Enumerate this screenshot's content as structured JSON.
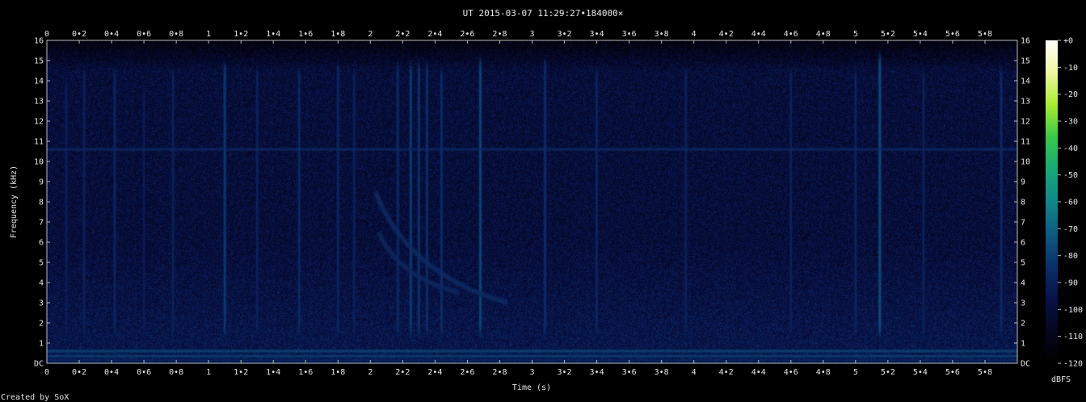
{
  "chart_data": {
    "type": "heatmap",
    "title": "UT 2015-03-07 11:29:27•184000×",
    "xlabel": "Time (s)",
    "ylabel": "Frequency (kHz)",
    "xlim": [
      0,
      6
    ],
    "ylim": [
      0,
      16
    ],
    "x_ticks": [
      {
        "v": 0,
        "label": "0"
      },
      {
        "v": 0.2,
        "label": "0•2"
      },
      {
        "v": 0.4,
        "label": "0•4"
      },
      {
        "v": 0.6,
        "label": "0•6"
      },
      {
        "v": 0.8,
        "label": "0•8"
      },
      {
        "v": 1,
        "label": "1"
      },
      {
        "v": 1.2,
        "label": "1•2"
      },
      {
        "v": 1.4,
        "label": "1•4"
      },
      {
        "v": 1.6,
        "label": "1•6"
      },
      {
        "v": 1.8,
        "label": "1•8"
      },
      {
        "v": 2,
        "label": "2"
      },
      {
        "v": 2.2,
        "label": "2•2"
      },
      {
        "v": 2.4,
        "label": "2•4"
      },
      {
        "v": 2.6,
        "label": "2•6"
      },
      {
        "v": 2.8,
        "label": "2•8"
      },
      {
        "v": 3,
        "label": "3"
      },
      {
        "v": 3.2,
        "label": "3•2"
      },
      {
        "v": 3.4,
        "label": "3•4"
      },
      {
        "v": 3.6,
        "label": "3•6"
      },
      {
        "v": 3.8,
        "label": "3•8"
      },
      {
        "v": 4,
        "label": "4"
      },
      {
        "v": 4.2,
        "label": "4•2"
      },
      {
        "v": 4.4,
        "label": "4•4"
      },
      {
        "v": 4.6,
        "label": "4•6"
      },
      {
        "v": 4.8,
        "label": "4•8"
      },
      {
        "v": 5,
        "label": "5"
      },
      {
        "v": 5.2,
        "label": "5•2"
      },
      {
        "v": 5.4,
        "label": "5•4"
      },
      {
        "v": 5.6,
        "label": "5•6"
      },
      {
        "v": 5.8,
        "label": "5•8"
      }
    ],
    "y_ticks": [
      {
        "v": 0,
        "label": "DC"
      },
      {
        "v": 1,
        "label": "1"
      },
      {
        "v": 2,
        "label": "2"
      },
      {
        "v": 3,
        "label": "3"
      },
      {
        "v": 4,
        "label": "4"
      },
      {
        "v": 5,
        "label": "5"
      },
      {
        "v": 6,
        "label": "6"
      },
      {
        "v": 7,
        "label": "7"
      },
      {
        "v": 8,
        "label": "8"
      },
      {
        "v": 9,
        "label": "9"
      },
      {
        "v": 10,
        "label": "10"
      },
      {
        "v": 11,
        "label": "11"
      },
      {
        "v": 12,
        "label": "12"
      },
      {
        "v": 13,
        "label": "13"
      },
      {
        "v": 14,
        "label": "14"
      },
      {
        "v": 15,
        "label": "15"
      },
      {
        "v": 16,
        "label": "16"
      }
    ],
    "colorbar": {
      "label": "dBFS",
      "range": [
        -120,
        0
      ],
      "ticks": [
        {
          "v": 0,
          "label": "+0"
        },
        {
          "v": -10,
          "label": "-10"
        },
        {
          "v": -20,
          "label": "-20"
        },
        {
          "v": -30,
          "label": "-30"
        },
        {
          "v": -40,
          "label": "-40"
        },
        {
          "v": -50,
          "label": "-50"
        },
        {
          "v": -60,
          "label": "-60"
        },
        {
          "v": -70,
          "label": "-70"
        },
        {
          "v": -80,
          "label": "-80"
        },
        {
          "v": -90,
          "label": "-90"
        },
        {
          "v": -100,
          "label": "-100"
        },
        {
          "v": -110,
          "label": "-110"
        },
        {
          "v": -120,
          "label": "-120"
        }
      ],
      "stops": [
        "#000000",
        "#05051e",
        "#08124a",
        "#0a2f6a",
        "#0d5a82",
        "#10878a",
        "#18a878",
        "#38c848",
        "#a8ec30",
        "#f0f8a0",
        "#ffffff"
      ]
    },
    "features": {
      "background_level_db": -100,
      "horizontal_lines": [
        {
          "freq_khz": 10.6,
          "level_db": -85
        },
        {
          "freq_khz": 0.6,
          "level_db": -75
        },
        {
          "freq_khz": 0.35,
          "level_db": -78
        },
        {
          "freq_khz": 0.15,
          "level_db": -88
        }
      ],
      "vertical_impulses": [
        {
          "t": 0.12,
          "top_khz": 14,
          "level_db": -92
        },
        {
          "t": 0.23,
          "top_khz": 14.5,
          "level_db": -90
        },
        {
          "t": 0.42,
          "top_khz": 14.5,
          "level_db": -88
        },
        {
          "t": 0.6,
          "top_khz": 13.5,
          "level_db": -92
        },
        {
          "t": 0.78,
          "top_khz": 14.5,
          "level_db": -90
        },
        {
          "t": 1.1,
          "top_khz": 14.8,
          "level_db": -80
        },
        {
          "t": 1.3,
          "top_khz": 14.5,
          "level_db": -90
        },
        {
          "t": 1.56,
          "top_khz": 14.5,
          "level_db": -86
        },
        {
          "t": 1.8,
          "top_khz": 14.8,
          "level_db": -88
        },
        {
          "t": 1.9,
          "top_khz": 14.5,
          "level_db": -90
        },
        {
          "t": 2.17,
          "top_khz": 14.8,
          "level_db": -86
        },
        {
          "t": 2.25,
          "top_khz": 14.8,
          "level_db": -80
        },
        {
          "t": 2.3,
          "top_khz": 14.8,
          "level_db": -82
        },
        {
          "t": 2.35,
          "top_khz": 14.8,
          "level_db": -84
        },
        {
          "t": 2.44,
          "top_khz": 14.5,
          "level_db": -84
        },
        {
          "t": 2.68,
          "top_khz": 15,
          "level_db": -76
        },
        {
          "t": 3.08,
          "top_khz": 15,
          "level_db": -84
        },
        {
          "t": 3.4,
          "top_khz": 14.5,
          "level_db": -88
        },
        {
          "t": 3.95,
          "top_khz": 14.5,
          "level_db": -90
        },
        {
          "t": 4.6,
          "top_khz": 14.5,
          "level_db": -90
        },
        {
          "t": 5.0,
          "top_khz": 14.5,
          "level_db": -88
        },
        {
          "t": 5.15,
          "top_khz": 15.2,
          "level_db": -74
        },
        {
          "t": 5.42,
          "top_khz": 14.5,
          "level_db": -90
        },
        {
          "t": 5.9,
          "top_khz": 14.5,
          "level_db": -86
        }
      ],
      "whistler_traces": [
        {
          "t_start": 2.03,
          "f_start_khz": 8.5,
          "t_end": 2.85,
          "f_end_khz": 3.0,
          "level_db": -86
        },
        {
          "t_start": 2.05,
          "f_start_khz": 6.5,
          "t_end": 2.55,
          "f_end_khz": 3.5,
          "level_db": -88
        }
      ]
    }
  },
  "footer": {
    "credit": "Created by SoX"
  }
}
